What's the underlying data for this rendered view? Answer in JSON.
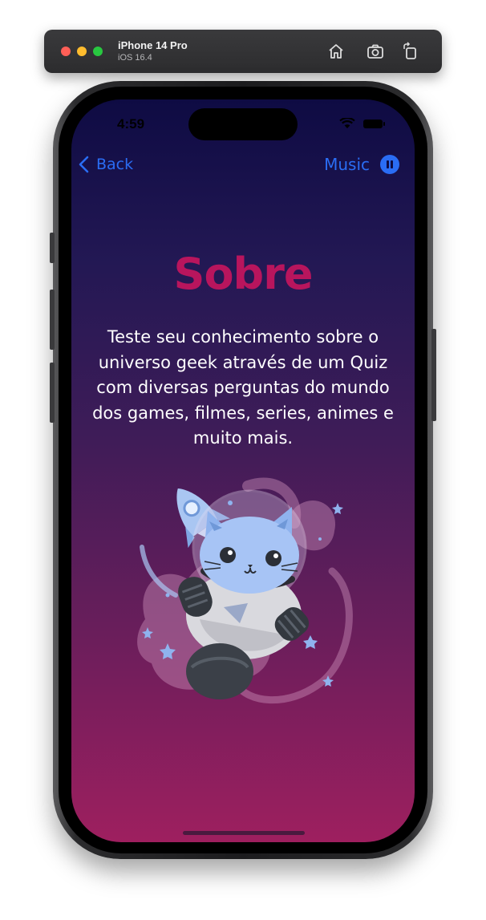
{
  "simulator": {
    "device_name": "iPhone 14 Pro",
    "os_version": "iOS 16.4"
  },
  "status_bar": {
    "time": "4:59"
  },
  "nav": {
    "back_label": "Back",
    "music_label": "Music"
  },
  "content": {
    "title": "Sobre",
    "description": "Teste seu conhecimento sobre o universo geek através de um Quiz com diversas perguntas do mundo dos games, filmes, series, animes e muito mais."
  },
  "colors": {
    "accent": "#2a6df4",
    "title": "#b8155d",
    "bg_top": "#0e0b43",
    "bg_bottom": "#9e1f5f"
  },
  "icons": [
    "home-icon",
    "screenshot-icon",
    "rotate-icon",
    "wifi-icon",
    "battery-icon",
    "chevron-left-icon",
    "pause-icon"
  ]
}
